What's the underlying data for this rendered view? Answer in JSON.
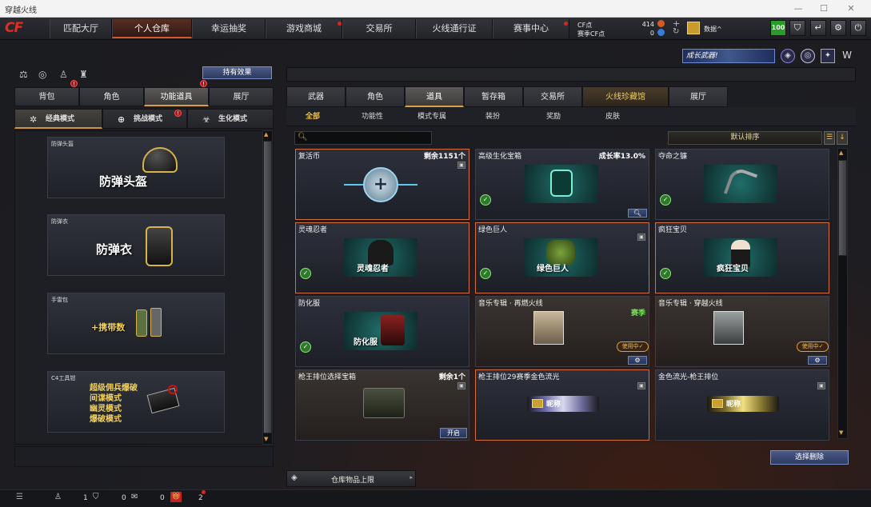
{
  "window": {
    "title": "穿越火线"
  },
  "nav": {
    "tabs": [
      {
        "label": "匹配大厅"
      },
      {
        "label": "个人仓库"
      },
      {
        "label": "幸运抽奖"
      },
      {
        "label": "游戏商城"
      },
      {
        "label": "交易所"
      },
      {
        "label": "火线通行证"
      },
      {
        "label": "赛事中心"
      }
    ]
  },
  "currency": {
    "cf_label": "CF点",
    "cf_value": "414",
    "season_label": "赛季CF点",
    "season_value": "0"
  },
  "user": {
    "name": "数据^",
    "level": "100"
  },
  "banner": {
    "text": "成长武器!"
  },
  "left": {
    "effect_button": "持有效果",
    "tabs": [
      {
        "label": "背包"
      },
      {
        "label": "角色"
      },
      {
        "label": "功能道具"
      },
      {
        "label": "展厅"
      }
    ],
    "modes": [
      {
        "label": "经典模式"
      },
      {
        "label": "挑战模式"
      },
      {
        "label": "生化模式"
      }
    ],
    "cards": [
      {
        "name": "防弹头盔",
        "big": "防弹头盔"
      },
      {
        "name": "防弹衣",
        "big": "防弹衣"
      },
      {
        "name": "手雷包",
        "big": "+携带数"
      },
      {
        "name": "C4工具钳",
        "l1": "超级佣兵爆破",
        "l2": "间谍模式",
        "l3": "幽灵模式",
        "l4": "爆破模式"
      }
    ]
  },
  "right": {
    "tabs": [
      {
        "label": "武器"
      },
      {
        "label": "角色"
      },
      {
        "label": "道具"
      },
      {
        "label": "暂存箱"
      },
      {
        "label": "交易所"
      },
      {
        "label": "火线珍藏馆"
      },
      {
        "label": "展厅"
      }
    ],
    "subtabs": [
      {
        "label": "全部"
      },
      {
        "label": "功能性"
      },
      {
        "label": "模式专属"
      },
      {
        "label": "装扮"
      },
      {
        "label": "奖励"
      },
      {
        "label": "皮肤"
      }
    ],
    "search": {
      "placeholder": ""
    },
    "sort": "默认排序",
    "items": [
      {
        "name": "复活币",
        "right": "剩余1151个"
      },
      {
        "name": "高级生化宝箱",
        "right": "成长率13.0%"
      },
      {
        "name": "夺命之镰",
        "right": ""
      },
      {
        "name": "灵魂忍者",
        "art": "灵魂忍者"
      },
      {
        "name": "绿色巨人",
        "art": "绿色巨人"
      },
      {
        "name": "疯狂宝贝",
        "art": "疯狂宝贝"
      },
      {
        "name": "防化服",
        "art": "防化服"
      },
      {
        "name": "音乐专辑 · 再燃火线",
        "tag": "赛季",
        "using": "使用中"
      },
      {
        "name": "音乐专辑 · 穿越火线",
        "using": "使用中"
      },
      {
        "name": "枪王排位选择宝箱",
        "right": "剩余1个",
        "open": "开启"
      },
      {
        "name": "枪王排位29赛季金色流光",
        "nick": "昵称"
      },
      {
        "name": "金色流光-枪王排位",
        "nick": "昵称"
      }
    ],
    "batch_delete": "选择删除",
    "storage_limit": "仓库物品上限"
  },
  "bottom": {
    "count1": "1",
    "count2": "0",
    "count3": "0",
    "count4": "2"
  },
  "colors": {
    "accent": "#d66d3c",
    "notify": "#e0241a"
  }
}
